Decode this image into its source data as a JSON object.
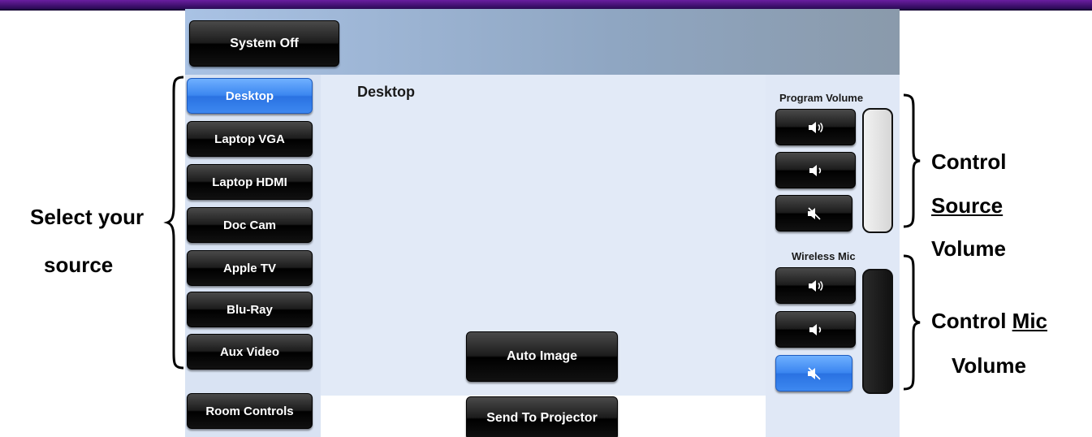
{
  "header": {
    "system_off_label": "System Off"
  },
  "sources": {
    "items": [
      {
        "label": "Desktop",
        "active": true
      },
      {
        "label": "Laptop VGA",
        "active": false
      },
      {
        "label": "Laptop HDMI",
        "active": false
      },
      {
        "label": "Doc Cam",
        "active": false
      },
      {
        "label": "Apple TV",
        "active": false
      },
      {
        "label": "Blu-Ray",
        "active": false
      },
      {
        "label": "Aux Video",
        "active": false
      }
    ],
    "room_controls_label": "Room Controls"
  },
  "main": {
    "current_source": "Desktop",
    "auto_image_label": "Auto Image",
    "send_to_projector_label": "Send To Projector"
  },
  "program_volume": {
    "title": "Program Volume",
    "buttons": [
      "volume-up-icon",
      "volume-down-icon",
      "mute-icon"
    ],
    "muted": false
  },
  "wireless_mic": {
    "title": "Wireless Mic",
    "buttons": [
      "volume-up-icon",
      "volume-down-icon",
      "mute-icon"
    ],
    "muted": true
  },
  "annotations": {
    "select_line1": "Select your",
    "select_line2": "source",
    "source_line1": "Control",
    "source_line2": "Source",
    "source_line3": "Volume",
    "mic_line1_a": "Control ",
    "mic_line1_b": "Mic",
    "mic_line2": "Volume"
  },
  "colors": {
    "active_blue": "#3b86f0",
    "button_black": "#111111",
    "top_bar": "#5b1890"
  }
}
